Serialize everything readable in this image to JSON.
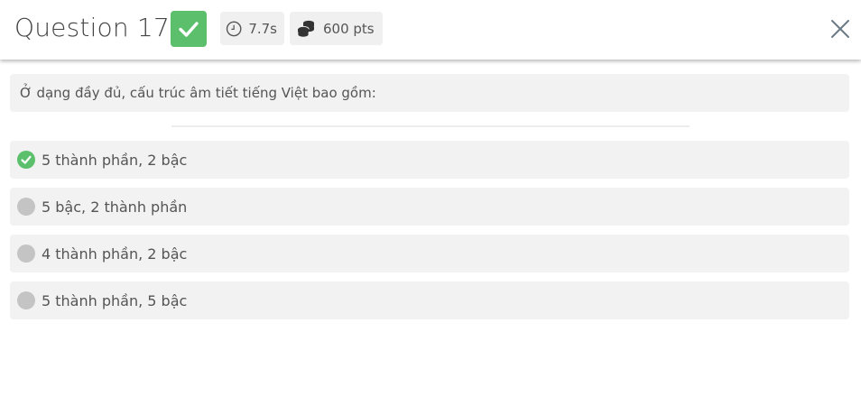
{
  "header": {
    "title": "Question 17",
    "status_icon": "check-icon",
    "timer": {
      "icon": "clock-icon",
      "value": "7.7s"
    },
    "points": {
      "icon": "coins-icon",
      "value": "600 pts"
    },
    "close_icon": "close-icon"
  },
  "question": {
    "text": "Ở dạng đầy đủ, cấu trúc âm tiết tiếng Việt bao gồm:"
  },
  "answers": [
    {
      "label": "5 thành phần, 2 bậc",
      "state": "correct"
    },
    {
      "label": "5 bậc, 2 thành phần",
      "state": "neutral"
    },
    {
      "label": "4 thành phần, 2 bậc",
      "state": "neutral"
    },
    {
      "label": "5 thành phần, 5 bậc",
      "state": "neutral"
    }
  ],
  "colors": {
    "correct": "#5cbf6c",
    "neutral": "#c4c4c4",
    "panel": "#f2f2f2",
    "text": "#555555",
    "close": "#6b7b86"
  }
}
